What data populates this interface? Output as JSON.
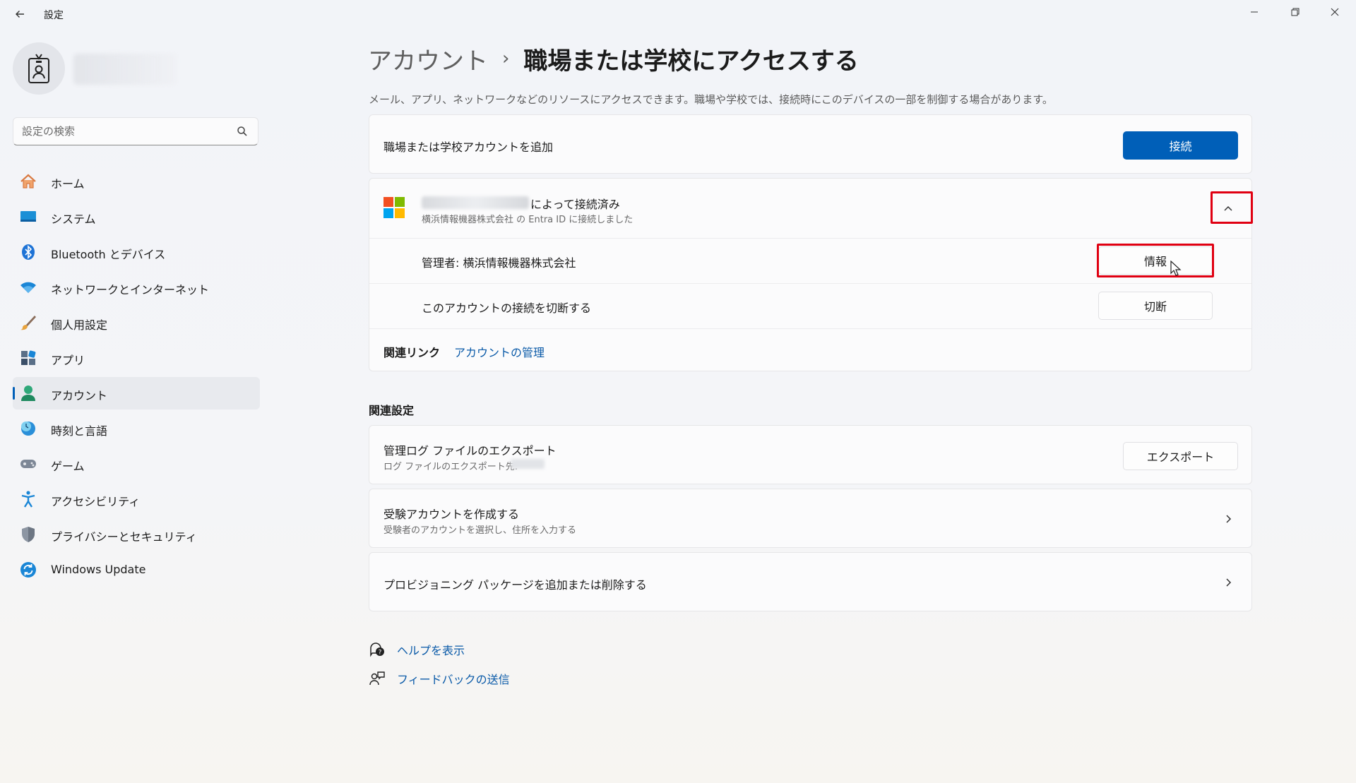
{
  "window": {
    "title": "設定"
  },
  "sidebar": {
    "search_placeholder": "設定の検索",
    "items": [
      {
        "label": "ホーム",
        "icon": "home-icon",
        "active": false
      },
      {
        "label": "システム",
        "icon": "system-icon",
        "active": false
      },
      {
        "label": "Bluetooth とデバイス",
        "icon": "bluetooth-icon",
        "active": false
      },
      {
        "label": "ネットワークとインターネット",
        "icon": "wifi-icon",
        "active": false
      },
      {
        "label": "個人用設定",
        "icon": "brush-icon",
        "active": false
      },
      {
        "label": "アプリ",
        "icon": "apps-icon",
        "active": false
      },
      {
        "label": "アカウント",
        "icon": "account-icon",
        "active": true
      },
      {
        "label": "時刻と言語",
        "icon": "globe-clock-icon",
        "active": false
      },
      {
        "label": "ゲーム",
        "icon": "gamepad-icon",
        "active": false
      },
      {
        "label": "アクセシビリティ",
        "icon": "accessibility-icon",
        "active": false
      },
      {
        "label": "プライバシーとセキュリティ",
        "icon": "shield-icon",
        "active": false
      },
      {
        "label": "Windows Update",
        "icon": "windows-update-icon",
        "active": false
      }
    ]
  },
  "main": {
    "breadcrumb_parent": "アカウント",
    "breadcrumb_separator": "›",
    "page_title": "職場または学校にアクセスする",
    "description": "メール、アプリ、ネットワークなどのリソースにアクセスできます。職場や学校では、接続時にこのデバイスの一部を制御する場合があります。",
    "add_account": {
      "label": "職場または学校アカウントを追加",
      "button": "接続"
    },
    "connected_account": {
      "title_suffix": "によって接続済み",
      "subtitle": "横浜情報機器株式会社 の Entra ID に接続しました",
      "admin_label": "管理者: 横浜情報機器株式会社",
      "info_button": "情報",
      "disconnect_label": "このアカウントの接続を切断する",
      "disconnect_button": "切断",
      "related_links_label": "関連リンク",
      "manage_account_link": "アカウントの管理"
    },
    "related_settings_title": "関連設定",
    "export_logs": {
      "label": "管理ログ ファイルのエクスポート",
      "sub": "ログ ファイルのエクスポート先:",
      "button": "エクスポート"
    },
    "exam_account": {
      "label": "受験アカウントを作成する",
      "sub": "受験者のアカウントを選択し、住所を入力する"
    },
    "provisioning": {
      "label": "プロビジョニング パッケージを追加または削除する"
    },
    "help_link": "ヘルプを表示",
    "feedback_link": "フィードバックの送信"
  },
  "colors": {
    "accent": "#005fb8",
    "highlight_box": "#e00012",
    "link": "#0a5aa8"
  }
}
